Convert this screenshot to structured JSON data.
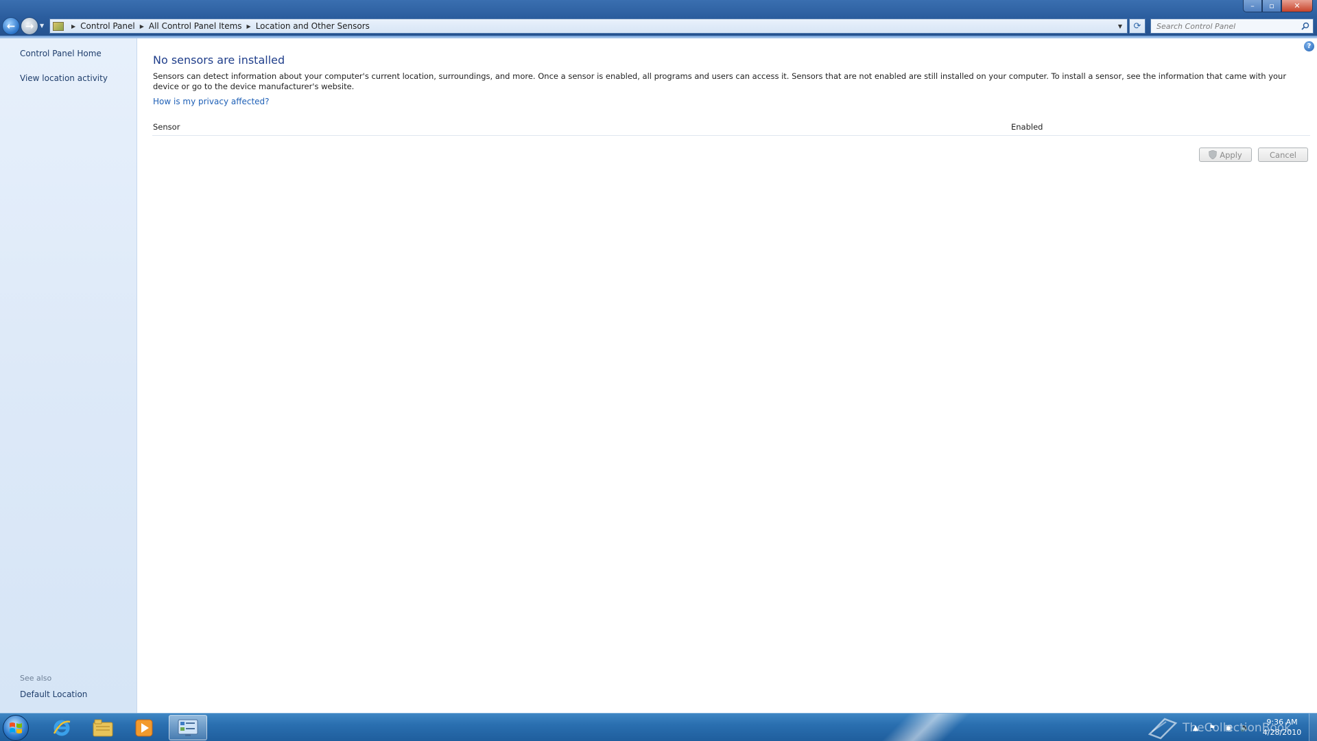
{
  "window": {
    "controls": {
      "minimize": "–",
      "maximize": "▫",
      "close": "✕"
    }
  },
  "nav": {
    "back_glyph": "←",
    "forward_glyph": "→",
    "breadcrumbs": [
      "Control Panel",
      "All Control Panel Items",
      "Location and Other Sensors"
    ],
    "refresh_glyph": "⟳",
    "search_placeholder": "Search Control Panel"
  },
  "sidebar": {
    "links": [
      "Control Panel Home",
      "View location activity"
    ],
    "see_also_label": "See also",
    "see_also_links": [
      "Default Location"
    ]
  },
  "main": {
    "title": "No sensors are installed",
    "description": "Sensors can detect information about your computer's current location, surroundings, and more. Once a sensor is enabled, all programs and users can access it. Sensors that are not enabled are still installed on your computer. To install a sensor, see the information that came with your device or go to the device manufacturer's website.",
    "privacy_link": "How is my privacy affected?",
    "columns": [
      "Sensor",
      "Enabled"
    ],
    "rows": [],
    "buttons": {
      "apply": "Apply",
      "cancel": "Cancel"
    },
    "help_glyph": "?"
  },
  "taskbar": {
    "pinned": [
      "internet-explorer",
      "windows-explorer",
      "media-player",
      "control-panel"
    ],
    "watermark": "TheCollectionBook",
    "clock": {
      "time": "9:36 AM",
      "date": "4/28/2010"
    }
  },
  "colors": {
    "title_blue": "#1e3d8a",
    "link_blue": "#1d5fb6",
    "sidebar_bg": "#dde9f8",
    "taskbar_blue": "#2a6fb0"
  }
}
